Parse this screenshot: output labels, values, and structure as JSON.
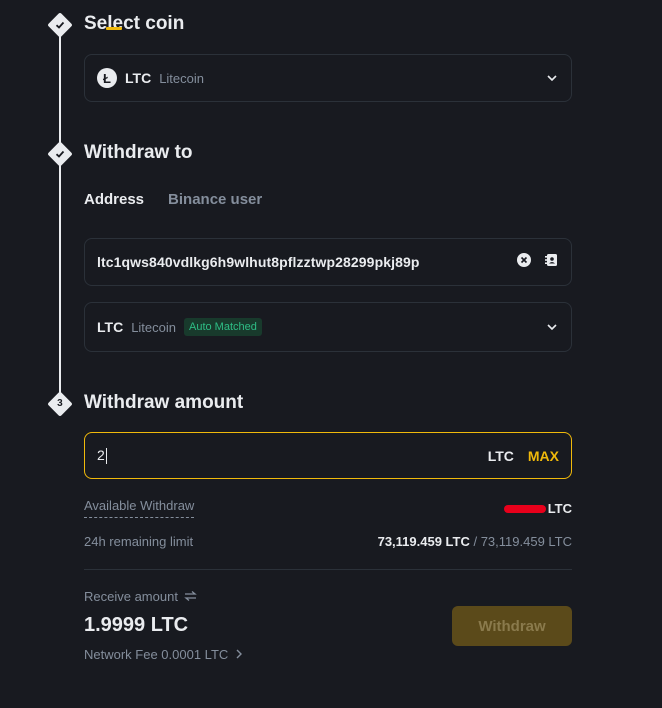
{
  "steps": [
    {
      "title": "Select coin",
      "marker": "check"
    },
    {
      "title": "Withdraw to",
      "marker": "check"
    },
    {
      "title": "Withdraw amount",
      "marker": "3"
    }
  ],
  "coin_select": {
    "symbol": "LTC",
    "name": "Litecoin",
    "logo_letter": "Ł"
  },
  "withdraw_tabs": [
    {
      "label": "Address",
      "active": true
    },
    {
      "label": "Binance user",
      "active": false
    }
  ],
  "address": {
    "value": "ltc1qws840vdlkg6h9wlhut8pflzztwp28299pkj89p"
  },
  "network": {
    "symbol": "LTC",
    "name": "Litecoin",
    "badge": "Auto Matched"
  },
  "amount": {
    "value": "2",
    "unit": "LTC",
    "max_label": "MAX"
  },
  "available": {
    "label": "Available Withdraw",
    "value_suffix": "LTC"
  },
  "limit": {
    "label": "24h remaining limit",
    "remaining": "73,119.459 LTC",
    "total": " / 73,119.459 LTC"
  },
  "receive": {
    "label": "Receive amount",
    "amount": "1.9999 LTC"
  },
  "fee": {
    "label": "Network Fee 0.0001 LTC"
  },
  "withdraw_button": {
    "label": "Withdraw"
  },
  "colors": {
    "accent": "#f0b90b",
    "background": "#181a20",
    "badge_green": "#2ebd85",
    "redaction": "#e8001b"
  }
}
